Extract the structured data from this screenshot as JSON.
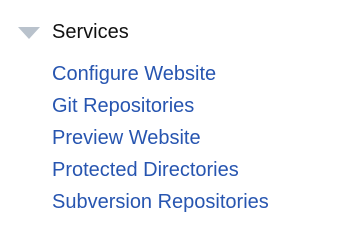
{
  "menu": {
    "section": {
      "title": "Services",
      "expanded": true,
      "icon": "expanded-triangle-icon"
    },
    "items": [
      {
        "label": "Configure Website"
      },
      {
        "label": "Git Repositories"
      },
      {
        "label": "Preview Website"
      },
      {
        "label": "Protected Directories"
      },
      {
        "label": "Subversion Repositories"
      }
    ]
  },
  "colors": {
    "link": "#2755b0",
    "header_text": "#111111",
    "triangle": "#b9c2cc",
    "background": "#ffffff"
  }
}
